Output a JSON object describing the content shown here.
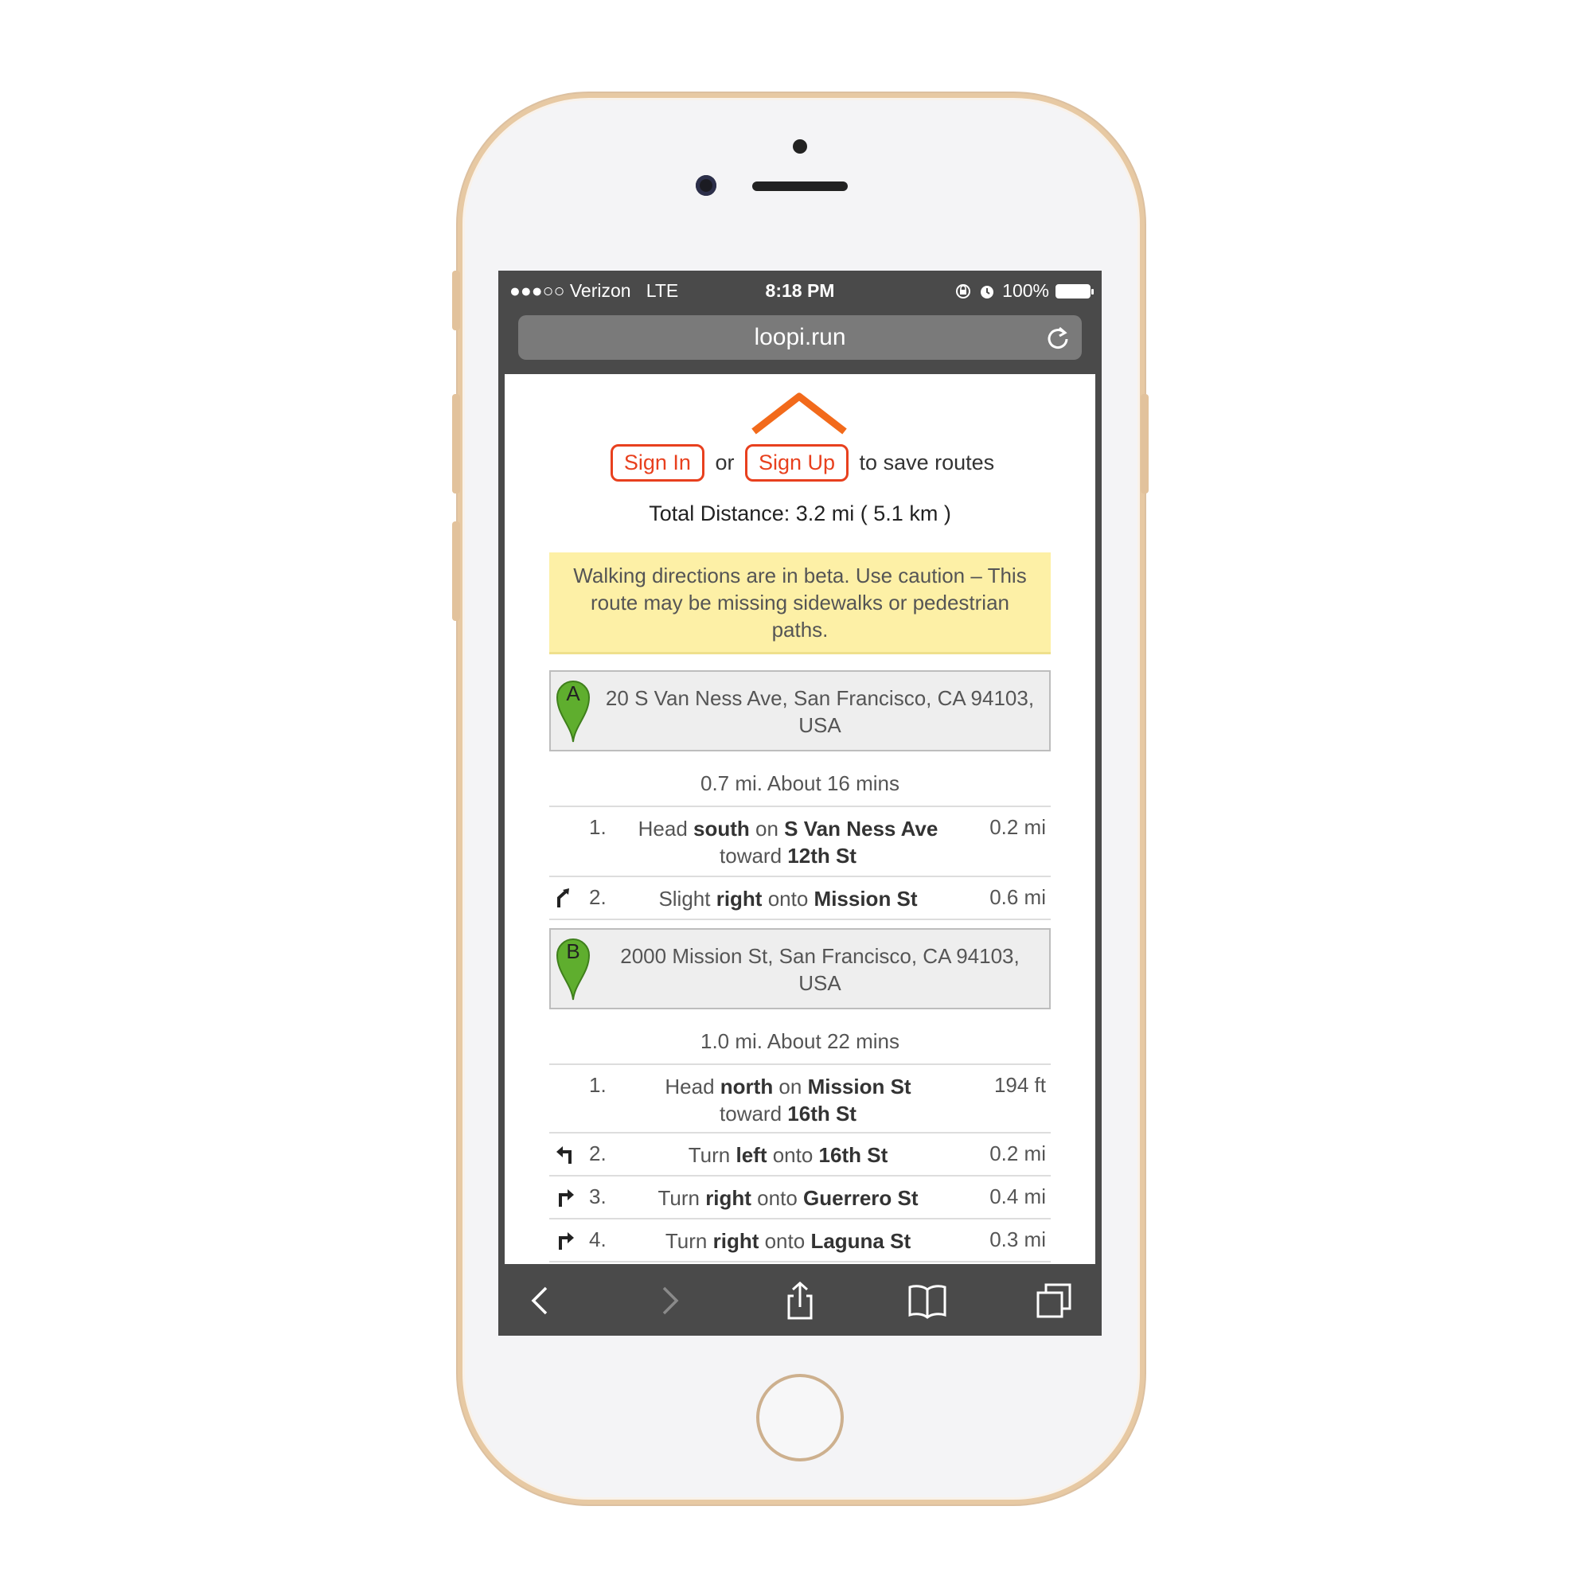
{
  "status_bar": {
    "carrier": "●●●○○ Verizon",
    "network": "LTE",
    "time": "8:18 PM",
    "battery": "100%"
  },
  "browser": {
    "url": "loopi.run"
  },
  "auth": {
    "sign_in": "Sign In",
    "or": "or",
    "sign_up": "Sign Up",
    "suffix": "to save routes"
  },
  "route": {
    "total_distance": "Total Distance: 3.2 mi ( 5.1 km )",
    "beta_warning": "Walking directions are in beta. Use caution – This route may be missing sidewalks or pedestrian paths.",
    "legs": [
      {
        "start_letter": "A",
        "start_address": "20 S Van Ness Ave, San Francisco, CA 94103, USA",
        "summary": "0.7 mi. About 16 mins",
        "steps": [
          {
            "num": "1.",
            "pre1": "Head ",
            "b1": "south",
            "pre2": " on ",
            "b2": "S Van Ness Ave",
            "pre3": " toward ",
            "b3": "12th St",
            "dist": "0.2 mi",
            "icon": "none"
          },
          {
            "num": "2.",
            "pre1": "Slight ",
            "b1": "right",
            "pre2": " onto ",
            "b2": "Mission St",
            "pre3": "",
            "b3": "",
            "dist": "0.6 mi",
            "icon": "slight-right-icon"
          }
        ]
      },
      {
        "start_letter": "B",
        "start_address": "2000 Mission St, San Francisco, CA 94103, USA",
        "summary": "1.0 mi. About 22 mins",
        "steps": [
          {
            "num": "1.",
            "pre1": "Head ",
            "b1": "north",
            "pre2": " on ",
            "b2": "Mission St",
            "pre3": " toward ",
            "b3": "16th St",
            "dist": "194 ft",
            "icon": "none"
          },
          {
            "num": "2.",
            "pre1": "Turn ",
            "b1": "left",
            "pre2": " onto ",
            "b2": "16th St",
            "pre3": "",
            "b3": "",
            "dist": "0.2 mi",
            "icon": "turn-left-icon"
          },
          {
            "num": "3.",
            "pre1": "Turn ",
            "b1": "right",
            "pre2": " onto ",
            "b2": "Guerrero St",
            "pre3": "",
            "b3": "",
            "dist": "0.4 mi",
            "icon": "turn-right-icon"
          },
          {
            "num": "4.",
            "pre1": "Turn ",
            "b1": "right",
            "pre2": " onto ",
            "b2": "Laguna St",
            "pre3": "",
            "b3": "",
            "dist": "0.3 mi",
            "icon": "turn-right-icon"
          }
        ]
      }
    ]
  },
  "colors": {
    "accent": "#e8401e",
    "logo": "#f26a1b",
    "pin": "#5fae2e",
    "warning_bg": "#fdf0a6",
    "browser_chrome": "#4a4a4a"
  }
}
